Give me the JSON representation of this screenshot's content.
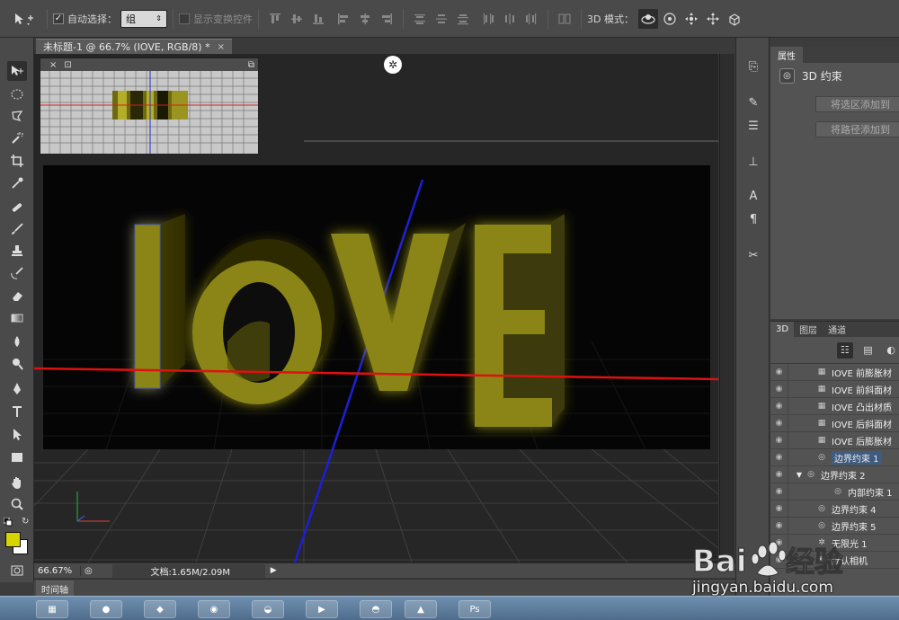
{
  "options_bar": {
    "auto_select_label": "自动选择：",
    "auto_select_value": "组",
    "show_transform_label": "显示变换控件",
    "mode_3d_label": "3D 模式："
  },
  "document": {
    "tab_title": "未标题-1 @ 66.7% (IOVE, RGB/8) *",
    "scene_text": "IOVE"
  },
  "status": {
    "zoom": "66.67%",
    "doc_info": "文档:1.65M/2.09M"
  },
  "timeline": {
    "tab_label": "时间轴"
  },
  "properties": {
    "tab_label": "属性",
    "constraint_title": "3D 约束",
    "btn_add_selection": "将选区添加到",
    "btn_add_path": "将路径添加到"
  },
  "panel_3d": {
    "tabs": [
      "3D",
      "图层",
      "通道"
    ],
    "rows": [
      {
        "label": "IOVE 前膨胀材",
        "icon": "material-icon",
        "indent": 1,
        "selected": false
      },
      {
        "label": "IOVE 前斜面材",
        "icon": "material-icon",
        "indent": 1,
        "selected": false
      },
      {
        "label": "IOVE 凸出材质",
        "icon": "material-icon",
        "indent": 1,
        "selected": false
      },
      {
        "label": "IOVE 后斜面材",
        "icon": "material-icon",
        "indent": 1,
        "selected": false
      },
      {
        "label": "IOVE 后膨胀材",
        "icon": "material-icon",
        "indent": 1,
        "selected": false
      },
      {
        "label": "边界约束 1",
        "icon": "constraint-icon",
        "indent": 1,
        "selected": true
      },
      {
        "label": "边界约束 2",
        "icon": "constraint-icon",
        "indent": 0,
        "selected": false,
        "expanded": true
      },
      {
        "label": "内部约束 1",
        "icon": "constraint-icon",
        "indent": 2,
        "selected": false
      },
      {
        "label": "边界约束 4",
        "icon": "constraint-icon",
        "indent": 1,
        "selected": false
      },
      {
        "label": "边界约束 5",
        "icon": "constraint-icon",
        "indent": 1,
        "selected": false
      },
      {
        "label": "无限光 1",
        "icon": "light-icon",
        "indent": 1,
        "selected": false
      },
      {
        "label": "默认相机",
        "icon": "camera-icon",
        "indent": 1,
        "selected": false
      }
    ]
  },
  "colors": {
    "foreground": "#d7d400",
    "background": "#ffffff",
    "text_3d": "#8a8513"
  },
  "watermark": {
    "logo": "Bai du 经验",
    "url": "jingyan.baidu.com"
  }
}
